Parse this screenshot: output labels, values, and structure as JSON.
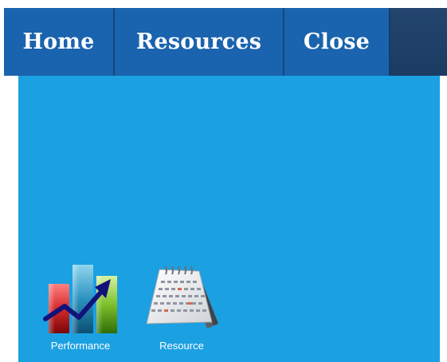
{
  "nav": {
    "tabs": [
      {
        "label": "Home"
      },
      {
        "label": "Resources"
      },
      {
        "label": "Close"
      }
    ]
  },
  "desktop": {
    "icons": [
      {
        "label": "Performance",
        "icon": "performance-chart-icon"
      },
      {
        "label": "Resource",
        "icon": "calendar-icon"
      }
    ]
  },
  "colors": {
    "topbar": "#1f416b",
    "tab": "#1a63ae",
    "panel": "#1ba0e2"
  }
}
